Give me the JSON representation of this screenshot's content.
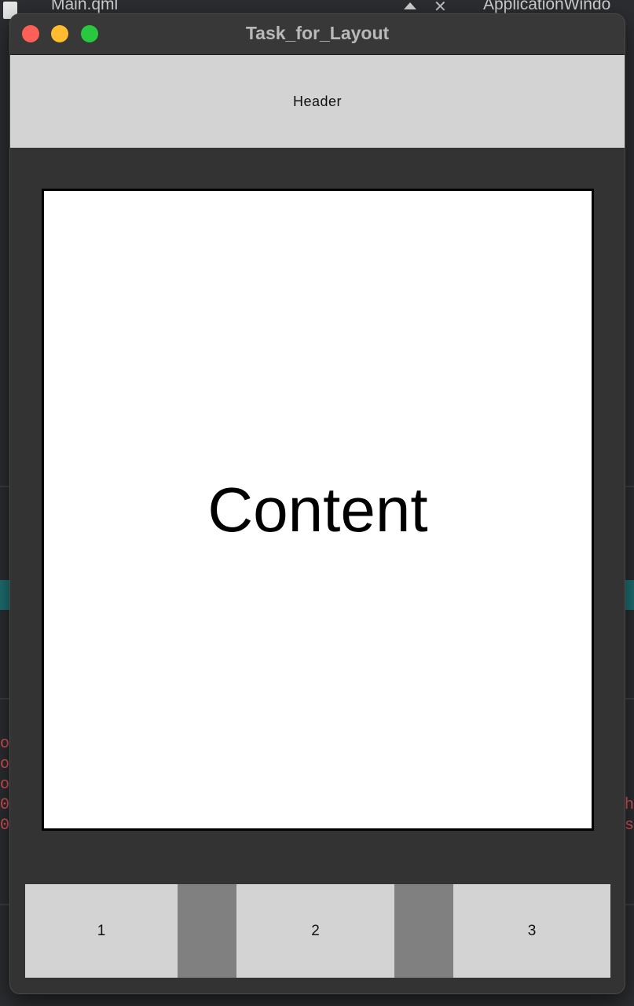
{
  "window": {
    "title": "Task_for_Layout"
  },
  "header": {
    "label": "Header"
  },
  "content": {
    "label": "Content"
  },
  "footer": {
    "buttons": [
      {
        "label": "1"
      },
      {
        "label": "2"
      },
      {
        "label": "3"
      }
    ]
  },
  "background_ide": {
    "tab_left": "Main.qml",
    "tab_right": "ApplicationWindo"
  },
  "colors": {
    "header_bg": "#d3d3d3",
    "window_bg": "#333333",
    "content_bg": "#ffffff",
    "divider_bg": "#808080",
    "traffic_red": "#fe5f57",
    "traffic_yellow": "#febc2e",
    "traffic_green": "#28c840"
  }
}
